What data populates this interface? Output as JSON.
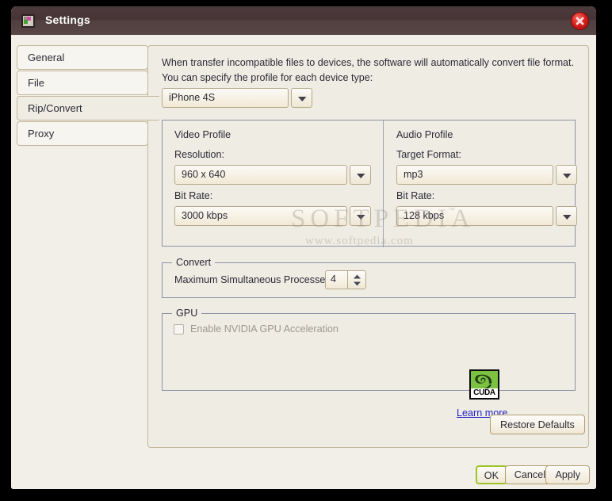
{
  "window": {
    "title": "Settings",
    "icon": "app-settings-icon",
    "close_icon": "close-icon",
    "accent_titlebar": "#463436",
    "accent_close": "#d8201c",
    "body_bg": "#efece4"
  },
  "sidebar": {
    "items": [
      {
        "label": "General",
        "selected": false
      },
      {
        "label": "File",
        "selected": false
      },
      {
        "label": "Rip/Convert",
        "selected": true
      },
      {
        "label": "Proxy",
        "selected": false
      }
    ]
  },
  "main": {
    "description": "When transfer incompatible files to devices, the software will automatically convert file format. You can specify the profile for each device type:",
    "device": {
      "label": "device-profile",
      "value": "iPhone 4S"
    },
    "video_profile": {
      "title": "Video Profile",
      "resolution_label": "Resolution:",
      "resolution_value": "960 x 640",
      "bitrate_label": "Bit Rate:",
      "bitrate_value": "3000 kbps"
    },
    "audio_profile": {
      "title": "Audio Profile",
      "target_format_label": "Target Format:",
      "target_format_value": "mp3",
      "bitrate_label": "Bit Rate:",
      "bitrate_value": "128 kbps"
    },
    "convert": {
      "legend": "Convert",
      "processes_label": "Maximum Simultaneous Processes:",
      "processes_value": "4"
    },
    "gpu": {
      "legend": "GPU",
      "checkbox_label": "Enable NVIDIA GPU Acceleration",
      "checked": false,
      "enabled": false,
      "logo_text": "CUDA",
      "link_text": "Learn more...",
      "link_color": "#2222cc"
    },
    "restore_defaults_label": "Restore Defaults"
  },
  "footer": {
    "ok_label": "OK",
    "cancel_label": "Cancel",
    "apply_label": "Apply"
  },
  "watermark": {
    "main": "SOFTPEDIA",
    "tm": "™",
    "sub": "www.softpedia.com"
  }
}
